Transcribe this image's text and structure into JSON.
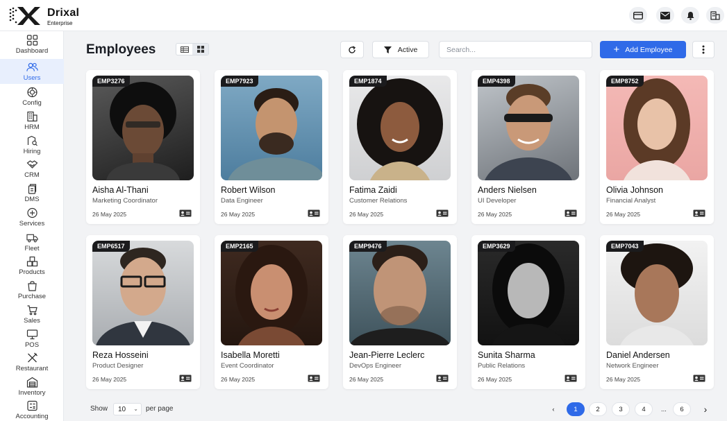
{
  "brand": {
    "name": "Drixal",
    "subtitle": "Enterprise"
  },
  "sidebar": {
    "items": [
      {
        "label": "Dashboard",
        "icon": "grid-icon",
        "active": false
      },
      {
        "label": "Users",
        "icon": "users-icon",
        "active": true
      },
      {
        "label": "Config",
        "icon": "config-icon",
        "active": false
      },
      {
        "label": "HRM",
        "icon": "building-icon",
        "active": false
      },
      {
        "label": "Hiring",
        "icon": "hiring-icon",
        "active": false
      },
      {
        "label": "CRM",
        "icon": "handshake-icon",
        "active": false
      },
      {
        "label": "DMS",
        "icon": "documents-icon",
        "active": false
      },
      {
        "label": "Services",
        "icon": "services-icon",
        "active": false
      },
      {
        "label": "Fleet",
        "icon": "truck-icon",
        "active": false
      },
      {
        "label": "Products",
        "icon": "boxes-icon",
        "active": false
      },
      {
        "label": "Purchase",
        "icon": "bag-icon",
        "active": false
      },
      {
        "label": "Sales",
        "icon": "cart-icon",
        "active": false
      },
      {
        "label": "POS",
        "icon": "monitor-icon",
        "active": false
      },
      {
        "label": "Restaurant",
        "icon": "utensils-icon",
        "active": false
      },
      {
        "label": "Inventory",
        "icon": "warehouse-icon",
        "active": false
      },
      {
        "label": "Accounting",
        "icon": "calculator-icon",
        "active": false
      }
    ]
  },
  "header": {
    "title": "Employees",
    "filter_label": "Active",
    "search_placeholder": "Search...",
    "add_label": "Add Employee"
  },
  "employees": [
    {
      "id": "EMP3276",
      "name": "Aisha Al-Thani",
      "role": "Marketing Coordinator",
      "date": "26 May 2025"
    },
    {
      "id": "EMP7923",
      "name": "Robert Wilson",
      "role": "Data Engineer",
      "date": "26 May 2025"
    },
    {
      "id": "EMP1874",
      "name": "Fatima Zaidi",
      "role": "Customer Relations",
      "date": "26 May 2025"
    },
    {
      "id": "EMP4398",
      "name": "Anders Nielsen",
      "role": "UI Developer",
      "date": "26 May 2025"
    },
    {
      "id": "EMP8752",
      "name": "Olivia Johnson",
      "role": "Financial Analyst",
      "date": "26 May 2025"
    },
    {
      "id": "EMP6517",
      "name": "Reza Hosseini",
      "role": "Product Designer",
      "date": "26 May 2025"
    },
    {
      "id": "EMP2165",
      "name": "Isabella Moretti",
      "role": "Event Coordinator",
      "date": "26 May 2025"
    },
    {
      "id": "EMP9476",
      "name": "Jean-Pierre Leclerc",
      "role": "DevOps Engineer",
      "date": "26 May 2025"
    },
    {
      "id": "EMP3629",
      "name": "Sunita Sharma",
      "role": "Public Relations",
      "date": "26 May 2025"
    },
    {
      "id": "EMP7043",
      "name": "Daniel Andersen",
      "role": "Network Engineer",
      "date": "26 May 2025"
    }
  ],
  "pagination": {
    "show_label": "Show",
    "per_page_value": "10",
    "per_page_label": "per page",
    "prev": "‹",
    "next": "›",
    "pages": [
      "1",
      "2",
      "3",
      "4",
      "...",
      "6"
    ],
    "current": "1"
  },
  "colors": {
    "accent": "#2f6ae8",
    "badge": "#1b1b1d",
    "background": "#f2f3f5"
  }
}
